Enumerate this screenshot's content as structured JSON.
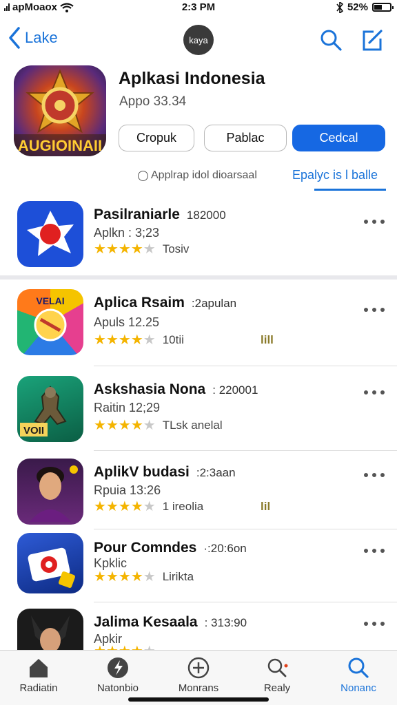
{
  "status_bar": {
    "carrier": "apMoaox",
    "time": "2:3 PM",
    "battery_text": "52%",
    "battery_level": 0.52
  },
  "nav": {
    "back_label": "Lake",
    "avatar_label": "kaya"
  },
  "header": {
    "title": "Aplkasi Indonesia",
    "subtitle": "Appo 33.34",
    "icon_text": "AUGIOINAII",
    "buttons": [
      "Cropuk",
      "Pablac",
      "Cedcal"
    ],
    "hint": "Applrap idol dioarsaal",
    "tab_link": "Epalyc is l balle"
  },
  "apps": [
    {
      "name": "Pasilraniarle",
      "meta": "182000",
      "sub": "Aplkn : 3;23",
      "rating": 4,
      "rating_text": "Tosiv",
      "extra": "",
      "icon": "red-dot-icon"
    },
    {
      "name": "Aplica Rsaim",
      "meta": ":2apulan",
      "sub": "Apuls 12.25",
      "rating": 4,
      "rating_text": "10tii",
      "extra": "lill",
      "icon": "colorful-wheel-icon"
    },
    {
      "name": "Askshasia Nona",
      "meta": ": 220001",
      "sub": "Raitin 12;29",
      "rating": 4,
      "rating_text": "TLsk anelal",
      "extra": "",
      "icon": "warrior-game-icon"
    },
    {
      "name": "AplikV budasi",
      "meta": ":2:3aan",
      "sub": "Rpuia 13:26",
      "rating": 4,
      "rating_text": "1 ireolia",
      "extra": "lil",
      "icon": "portrait-icon"
    },
    {
      "name": "Pour Comndes",
      "meta": "·:20:6on",
      "sub": "Kpklic",
      "rating": 4,
      "rating_text": "Lirikta",
      "extra": "",
      "icon": "board-game-icon"
    },
    {
      "name": "Jalima Kesaala",
      "meta": ": 313:90",
      "sub": "Apkir",
      "rating": 4,
      "rating_text": "",
      "extra": "",
      "icon": "character-icon"
    }
  ],
  "tabbar": [
    {
      "label": "Radiatin",
      "icon": "home-icon",
      "active": false
    },
    {
      "label": "Natonbio",
      "icon": "sport-icon",
      "active": false
    },
    {
      "label": "Monrans",
      "icon": "plus-circle-icon",
      "active": false
    },
    {
      "label": "Realy",
      "icon": "search-dot-icon",
      "active": false
    },
    {
      "label": "Nonanc",
      "icon": "search-icon",
      "active": true
    }
  ],
  "colors": {
    "accent": "#1668e3",
    "star": "#f4b400",
    "divider": "#e8e8ec"
  }
}
